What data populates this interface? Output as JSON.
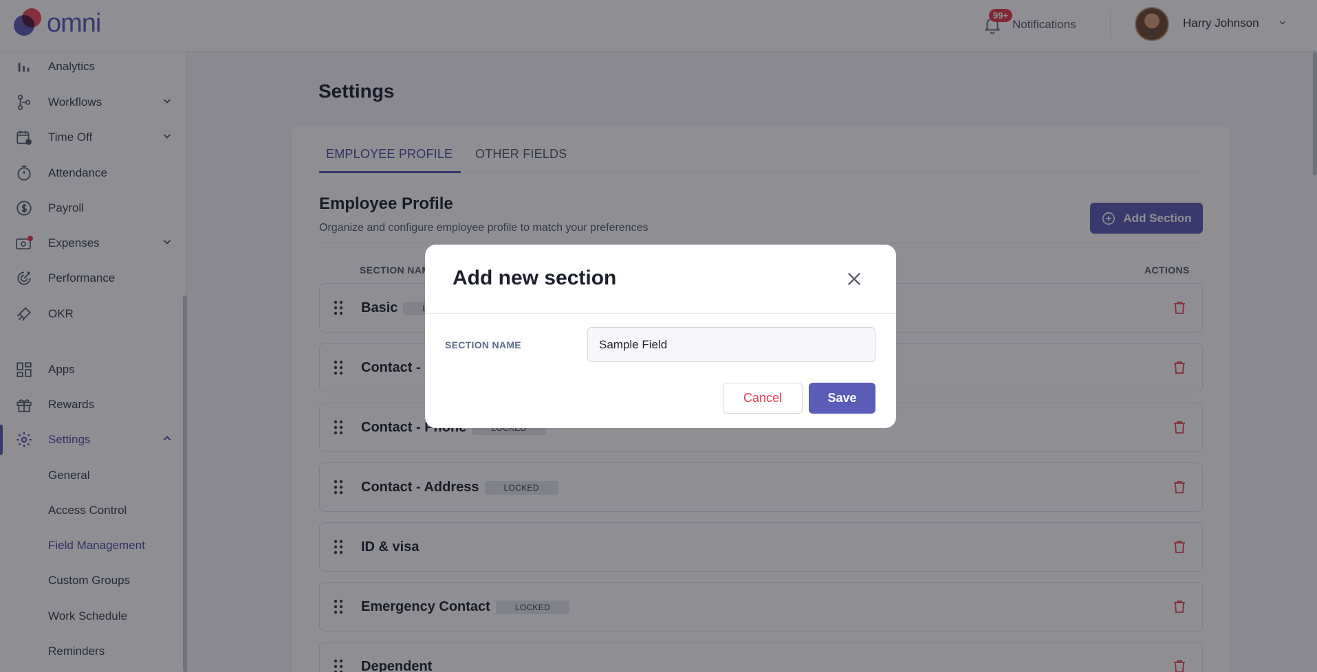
{
  "app": {
    "brand": "omni"
  },
  "header": {
    "notifications_badge": "99+",
    "notifications_label": "Notifications",
    "user_name": "Harry Johnson"
  },
  "sidebar": {
    "items": [
      {
        "label": "Analytics",
        "icon": "bar-chart-icon"
      },
      {
        "label": "Workflows",
        "icon": "workflow-icon",
        "expandable": true
      },
      {
        "label": "Time Off",
        "icon": "calendar-clock-icon",
        "expandable": true
      },
      {
        "label": "Attendance",
        "icon": "stopwatch-icon"
      },
      {
        "label": "Payroll",
        "icon": "dollar-circle-icon"
      },
      {
        "label": "Expenses",
        "icon": "wallet-icon",
        "expandable": true
      },
      {
        "label": "Performance",
        "icon": "target-icon"
      },
      {
        "label": "OKR",
        "icon": "rocket-icon"
      },
      {
        "label": "Apps",
        "icon": "apps-grid-icon"
      },
      {
        "label": "Rewards",
        "icon": "gift-icon"
      },
      {
        "label": "Settings",
        "icon": "gear-icon",
        "expanded": true
      }
    ],
    "settings_sub": [
      "General",
      "Access Control",
      "Field Management",
      "Custom Groups",
      "Work Schedule",
      "Reminders"
    ]
  },
  "main": {
    "page_title": "Settings",
    "tabs": [
      {
        "label": "EMPLOYEE PROFILE",
        "active": true
      },
      {
        "label": "OTHER FIELDS",
        "active": false
      }
    ],
    "section_title": "Employee Profile",
    "section_subtitle": "Organize and configure employee profile to match your preferences",
    "add_section_label": "Add Section",
    "columns": {
      "name": "SECTION NAME",
      "actions": "ACTIONS"
    },
    "rows": [
      {
        "name": "Basic",
        "locked": true
      },
      {
        "name": "Contact - Email",
        "locked": true
      },
      {
        "name": "Contact - Phone",
        "locked": true
      },
      {
        "name": "Contact - Address",
        "locked": true
      },
      {
        "name": "ID & visa",
        "locked": false
      },
      {
        "name": "Emergency Contact",
        "locked": true
      },
      {
        "name": "Dependent",
        "locked": false
      }
    ],
    "locked_label": "LOCKED"
  },
  "modal": {
    "title": "Add new section",
    "field_label": "SECTION NAME",
    "field_value": "Sample Field",
    "cancel_label": "Cancel",
    "save_label": "Save"
  },
  "colors": {
    "accent": "#5b5bb8",
    "danger": "#e23b4e",
    "brand_red": "#e8485a"
  }
}
